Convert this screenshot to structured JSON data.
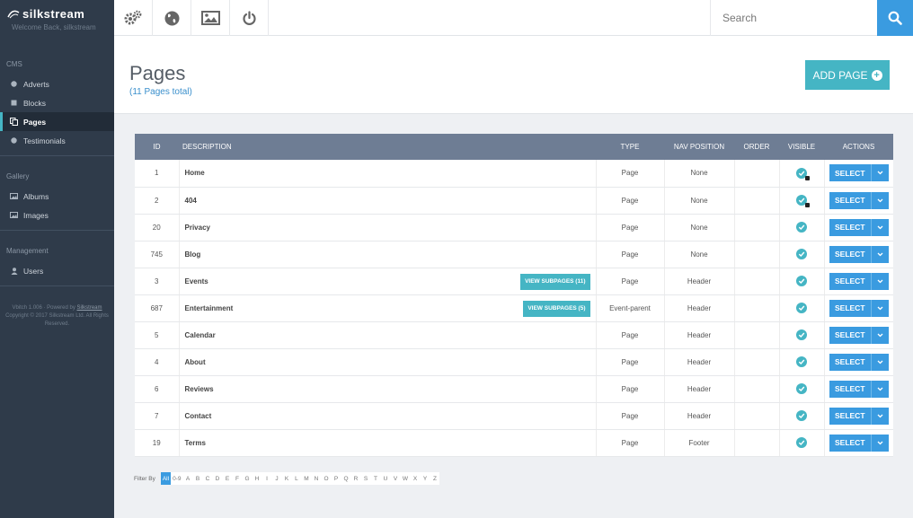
{
  "brand": {
    "name": "silkstream",
    "welcome": "Welcome Back, silkstream"
  },
  "sidebar": {
    "sections": [
      {
        "heading": "CMS",
        "items": [
          {
            "label": "Adverts",
            "icon": "circle-icon",
            "active": false
          },
          {
            "label": "Blocks",
            "icon": "square-icon",
            "active": false
          },
          {
            "label": "Pages",
            "icon": "copy-icon",
            "active": true
          },
          {
            "label": "Testimonials",
            "icon": "circle-icon",
            "active": false
          }
        ]
      },
      {
        "heading": "Gallery",
        "items": [
          {
            "label": "Albums",
            "icon": "image-icon",
            "active": false
          },
          {
            "label": "Images",
            "icon": "image-icon",
            "active": false
          }
        ]
      },
      {
        "heading": "Management",
        "items": [
          {
            "label": "Users",
            "icon": "user-icon",
            "active": false
          }
        ]
      }
    ],
    "footer": {
      "version": "Vbitch 1.006 · Powered by",
      "powered_link": "Silkstream",
      "copyright": "Copyright © 2017 Silkstream Ltd. All Rights Reserved."
    }
  },
  "topbar": {
    "icons": [
      "settings-icon",
      "globe-icon",
      "image-icon",
      "power-icon"
    ],
    "search_placeholder": "Search"
  },
  "header": {
    "title": "Pages",
    "subtitle": "(11 Pages total)",
    "add_label": "ADD PAGE"
  },
  "table": {
    "columns": {
      "id": "ID",
      "description": "DESCRIPTION",
      "type": "TYPE",
      "nav": "NAV POSITION",
      "order": "ORDER",
      "visible": "VISIBLE",
      "actions": "ACTIONS"
    },
    "select_label": "SELECT",
    "rows": [
      {
        "id": "1",
        "description": "Home",
        "type": "Page",
        "nav": "None",
        "order": "",
        "locked": true,
        "subpages": ""
      },
      {
        "id": "2",
        "description": "404",
        "type": "Page",
        "nav": "None",
        "order": "",
        "locked": true,
        "subpages": ""
      },
      {
        "id": "20",
        "description": "Privacy",
        "type": "Page",
        "nav": "None",
        "order": "",
        "locked": false,
        "subpages": ""
      },
      {
        "id": "745",
        "description": "Blog",
        "type": "Page",
        "nav": "None",
        "order": "",
        "locked": false,
        "subpages": ""
      },
      {
        "id": "3",
        "description": "Events",
        "type": "Page",
        "nav": "Header",
        "order": "",
        "locked": false,
        "subpages": "VIEW SUBPAGES (11)"
      },
      {
        "id": "687",
        "description": "Entertainment",
        "type": "Event-parent",
        "nav": "Header",
        "order": "",
        "locked": false,
        "subpages": "VIEW SUBPAGES (5)"
      },
      {
        "id": "5",
        "description": "Calendar",
        "type": "Page",
        "nav": "Header",
        "order": "",
        "locked": false,
        "subpages": ""
      },
      {
        "id": "4",
        "description": "About",
        "type": "Page",
        "nav": "Header",
        "order": "",
        "locked": false,
        "subpages": ""
      },
      {
        "id": "6",
        "description": "Reviews",
        "type": "Page",
        "nav": "Header",
        "order": "",
        "locked": false,
        "subpages": ""
      },
      {
        "id": "7",
        "description": "Contact",
        "type": "Page",
        "nav": "Header",
        "order": "",
        "locked": false,
        "subpages": ""
      },
      {
        "id": "19",
        "description": "Terms",
        "type": "Page",
        "nav": "Footer",
        "order": "",
        "locked": false,
        "subpages": ""
      }
    ]
  },
  "filter": {
    "label": "Filter By",
    "options": [
      "All",
      "0-9",
      "A",
      "B",
      "C",
      "D",
      "E",
      "F",
      "G",
      "H",
      "I",
      "J",
      "K",
      "L",
      "M",
      "N",
      "O",
      "P",
      "Q",
      "R",
      "S",
      "T",
      "U",
      "V",
      "W",
      "X",
      "Y",
      "Z"
    ],
    "active": "All"
  },
  "colors": {
    "accent": "#45b5c4",
    "primary": "#3a9be0",
    "sidebar": "#2f3b4a",
    "table_header": "#6e7d94"
  }
}
